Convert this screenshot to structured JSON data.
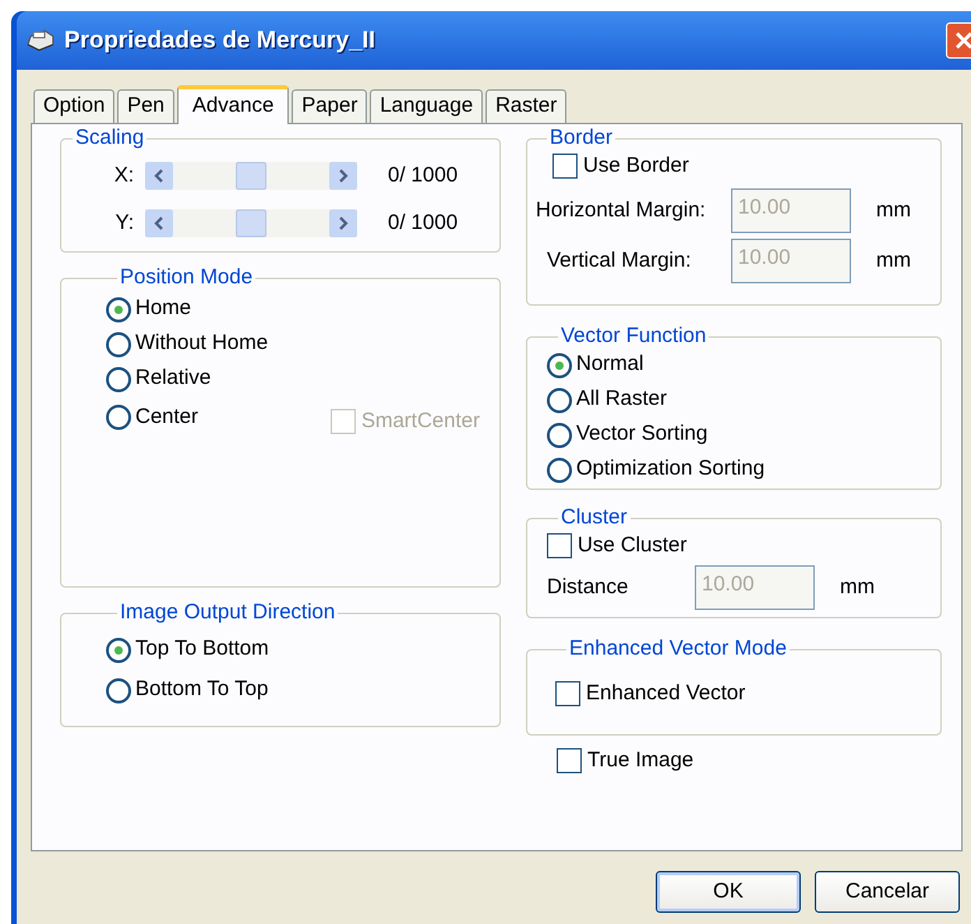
{
  "window": {
    "title": "Propriedades de Mercury_II"
  },
  "tabs": [
    {
      "label": "Option",
      "selected": false
    },
    {
      "label": "Pen",
      "selected": false
    },
    {
      "label": "Advance",
      "selected": true
    },
    {
      "label": "Paper",
      "selected": false
    },
    {
      "label": "Language",
      "selected": false
    },
    {
      "label": "Raster",
      "selected": false
    }
  ],
  "scaling": {
    "title": "Scaling",
    "rows": [
      {
        "label": "X:",
        "reading": "0/ 1000"
      },
      {
        "label": "Y:",
        "reading": "0/ 1000"
      }
    ]
  },
  "position_mode": {
    "title": "Position Mode",
    "options": [
      {
        "label": "Home",
        "selected": true
      },
      {
        "label": "Without Home",
        "selected": false
      },
      {
        "label": "Relative",
        "selected": false
      },
      {
        "label": "Center",
        "selected": false
      }
    ],
    "smart_center": {
      "label": "SmartCenter",
      "checked": false,
      "disabled": true
    }
  },
  "image_output_direction": {
    "title": "Image Output Direction",
    "options": [
      {
        "label": "Top To Bottom",
        "selected": true
      },
      {
        "label": "Bottom To Top",
        "selected": false
      }
    ]
  },
  "border": {
    "title": "Border",
    "use_border": {
      "label": "Use Border",
      "checked": false
    },
    "fields": [
      {
        "label": "Horizontal Margin:",
        "value": "10.00",
        "unit": "mm",
        "disabled": true
      },
      {
        "label": "Vertical Margin:",
        "value": "10.00",
        "unit": "mm",
        "disabled": true
      }
    ]
  },
  "vector_function": {
    "title": "Vector Function",
    "options": [
      {
        "label": "Normal",
        "selected": true
      },
      {
        "label": "All Raster",
        "selected": false
      },
      {
        "label": "Vector Sorting",
        "selected": false
      },
      {
        "label": "Optimization Sorting",
        "selected": false
      }
    ]
  },
  "cluster": {
    "title": "Cluster",
    "use_cluster": {
      "label": "Use Cluster",
      "checked": false
    },
    "field": {
      "label": "Distance",
      "value": "10.00",
      "unit": "mm",
      "disabled": true
    }
  },
  "enhanced_vector_mode": {
    "title": "Enhanced Vector Mode",
    "checkbox": {
      "label": "Enhanced Vector",
      "checked": false
    }
  },
  "true_image": {
    "label": "True Image",
    "checked": false
  },
  "buttons": [
    {
      "label": "OK",
      "default": true
    },
    {
      "label": "Cancelar",
      "default": false
    }
  ]
}
